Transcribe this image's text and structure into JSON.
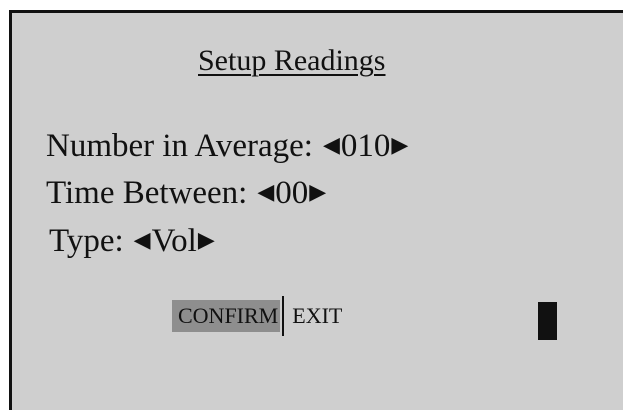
{
  "screen": {
    "title": "Setup Readings"
  },
  "fields": [
    {
      "label": "Number in Average:",
      "value": "010"
    },
    {
      "label": "Time Between:",
      "value": "00"
    },
    {
      "label": "Type:",
      "value": "Vol"
    }
  ],
  "icons": {
    "decrease": "left-triangle-icon",
    "increase": "right-triangle-icon"
  },
  "softkeys": {
    "confirm": "CONFIRM",
    "exit": "EXIT"
  },
  "colors": {
    "screen_background": "#cfcfcf",
    "highlight": "#8e8e8e",
    "ink": "#111111"
  }
}
